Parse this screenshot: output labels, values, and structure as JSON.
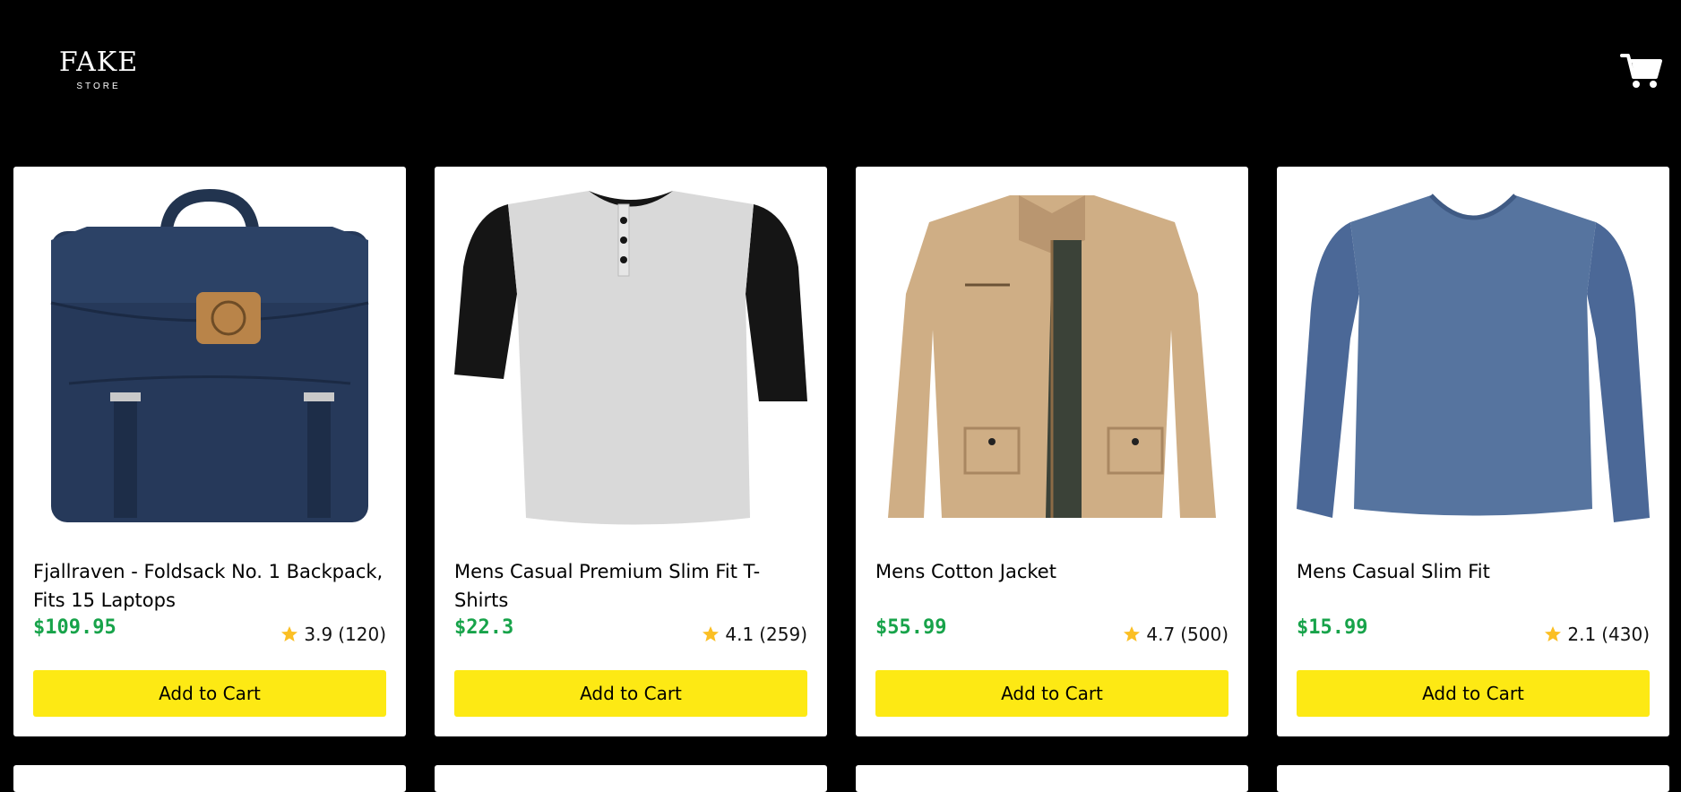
{
  "header": {
    "logo_main": "FAKE",
    "logo_sub": "STORE",
    "cart_icon": "shopping-cart-icon"
  },
  "products": [
    {
      "title": "Fjallraven - Foldsack No. 1 Backpack, Fits 15 Laptops",
      "price": "$109.95",
      "rating": "3.9",
      "count": "(120)",
      "button": "Add to Cart",
      "image": "navy-backpack"
    },
    {
      "title": "Mens Casual Premium Slim Fit T-Shirts",
      "price": "$22.3",
      "rating": "4.1",
      "count": "(259)",
      "button": "Add to Cart",
      "image": "raglan-henley-tshirt"
    },
    {
      "title": "Mens Cotton Jacket",
      "price": "$55.99",
      "rating": "4.7",
      "count": "(500)",
      "button": "Add to Cart",
      "image": "khaki-cotton-jacket"
    },
    {
      "title": "Mens Casual Slim Fit",
      "price": "$15.99",
      "rating": "2.1",
      "count": "(430)",
      "button": "Add to Cart",
      "image": "blue-long-sleeve-shirt"
    }
  ],
  "colors": {
    "background": "#000000",
    "price": "#17a34a",
    "button": "#fde914",
    "star": "#fbbf24"
  }
}
